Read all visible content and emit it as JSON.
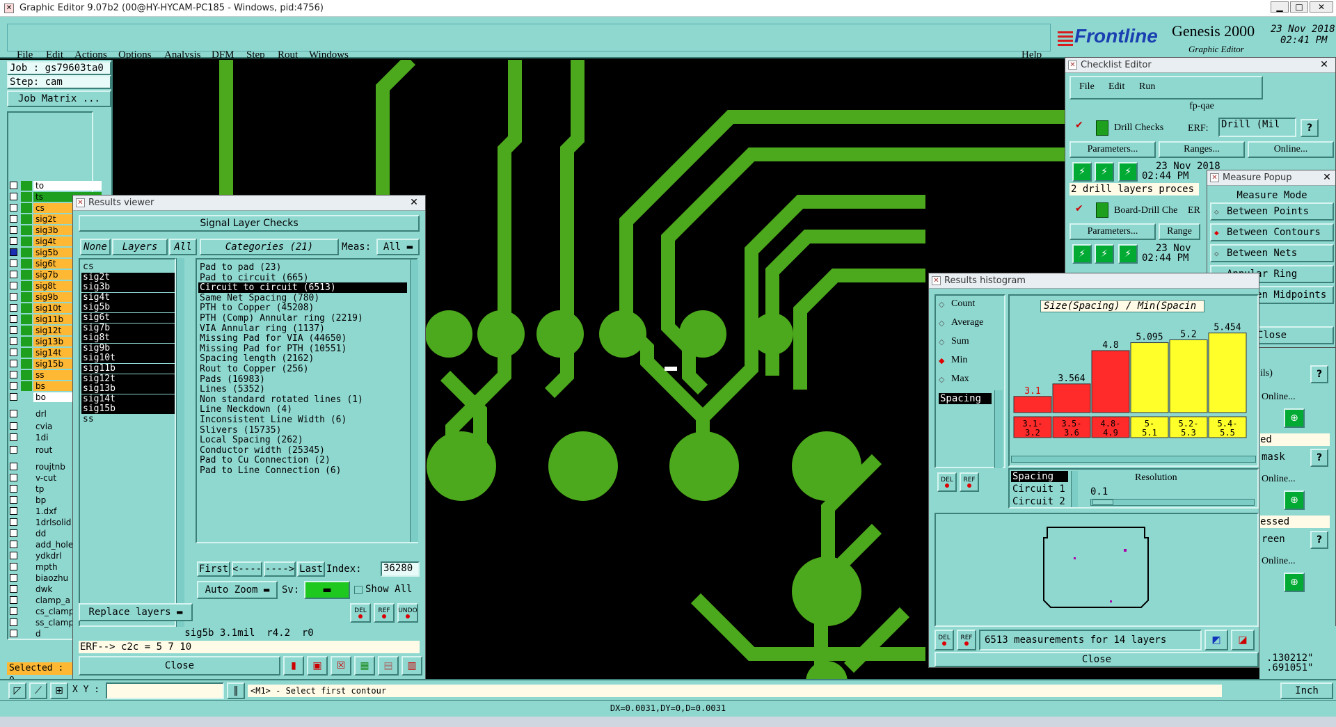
{
  "titlebar": {
    "text": "Graphic Editor 9.07b2 (00@HY-HYCAM-PC185 - Windows, pid:4756)"
  },
  "menubar": {
    "items": [
      "File",
      "Edit",
      "Actions",
      "Options",
      "Analysis",
      "DFM",
      "Step",
      "Rout",
      "Windows"
    ],
    "help": "Help"
  },
  "brand": {
    "logo": "Frontline",
    "product": "Genesis 2000",
    "subtitle": "Graphic Editor",
    "date": "23 Nov 2018",
    "time": "02:41 PM"
  },
  "left_panel": {
    "job": "Job : gs79603ta0",
    "step": "Step: cam",
    "job_matrix": "Job Matrix ...",
    "layers": [
      "to",
      "ts",
      "cs",
      "sig2t",
      "sig3b",
      "sig4t",
      "sig5b",
      "sig6t",
      "sig7b",
      "sig8t",
      "sig9b",
      "sig10t",
      "sig11b",
      "sig12t",
      "sig13b",
      "sig14t",
      "sig15b",
      "ss",
      "bs",
      "bo",
      "drl",
      "cvia",
      "1di",
      "rout",
      "roujtnb",
      "v-cut",
      "tp",
      "bp",
      "1.dxf",
      "1drlsolid",
      "dd",
      "add_hole",
      "ydkdrl",
      "mpth",
      "biaozhu",
      "dwk",
      "clamp_a",
      "cs_clamp",
      "ss_clamp",
      "d"
    ],
    "selected": "Selected : 0"
  },
  "results_viewer": {
    "title": "Results viewer",
    "header": "Signal Layer Checks",
    "none_btn": "None",
    "layers_btn": "Layers",
    "all_btn": "All",
    "categories_btn": "Categories (21)",
    "meas_label": "Meas:",
    "meas_value": "All",
    "layer_list": [
      "cs",
      "sig2t",
      "sig3b",
      "sig4t",
      "sig5b",
      "sig6t",
      "sig7b",
      "sig8t",
      "sig9b",
      "sig10t",
      "sig11b",
      "sig12t",
      "sig13b",
      "sig14t",
      "sig15b",
      "ss"
    ],
    "categories": [
      "Pad to pad (23)",
      "Pad to circuit (665)",
      "Circuit to circuit (6513)",
      "Same Net Spacing (780)",
      "PTH to Copper (45208)",
      "PTH (Comp) Annular ring (2219)",
      "VIA Annular ring (1137)",
      "Missing Pad for VIA (44650)",
      "Missing Pad for PTH (10551)",
      "Spacing length (2162)",
      "Rout to Copper (256)",
      "Pads (16983)",
      "Lines (5352)",
      "Non standard rotated lines (1)",
      "Line Neckdown (4)",
      "Inconsistent Line Width (6)",
      "Slivers (15735)",
      "Local Spacing (262)",
      "Conductor width (25345)",
      "Pad to Cu Connection (2)",
      "Pad to Line Connection (6)"
    ],
    "nav": {
      "first": "First",
      "prev": "<----",
      "next": "---->",
      "last": "Last",
      "index_label": "Index:",
      "index_value": "36280"
    },
    "auto_zoom": "Auto Zoom",
    "sv_label": "Sv:",
    "show_all": "Show All",
    "replace_layers": "Replace layers",
    "del": "DEL",
    "ref": "REF",
    "undo": "UNDO",
    "status": "sig5b 3.1mil  r4.2  r0",
    "erf": "ERF--> c2c = 5 7 10",
    "close": "Close"
  },
  "bottom": {
    "xy_label": "X Y :",
    "prompt": "<M1> - Select first contour",
    "status": "DX=0.0031,DY=0,D=0.0031",
    "inch": "Inch",
    "coords1": ".130212\"",
    "coords2": ".691051\""
  },
  "checklist_editor": {
    "title": "Checklist Editor",
    "menu": [
      "File",
      "Edit",
      "Run"
    ],
    "name": "fp-qae",
    "check1": "Drill Checks",
    "erf_label": "ERF:",
    "erf_value": "Drill (Mil",
    "params": "Parameters...",
    "ranges": "Ranges...",
    "online": "Online...",
    "date1": "23 Nov 2018",
    "time1": "02:44 PM",
    "msg1": "2 drill layers proces",
    "check2": "Board-Drill Che",
    "erf2": "ER",
    "ranges2": "Range",
    "date2": "23 Nov",
    "time2": "02:44 PM",
    "frag1": "ils)",
    "frag2": "Online...",
    "frag3": "ed",
    "frag4": "mask",
    "frag5": "Online...",
    "frag6": "essed",
    "frag7": "reen",
    "frag8": "Online..."
  },
  "measure_popup": {
    "title": "Measure Popup",
    "mode_label": "Measure Mode",
    "options": [
      "Between Points",
      "Between Contours",
      "Between Nets",
      "Annular Ring",
      "Between Midpoints"
    ],
    "selected_index": 1,
    "close": "Close"
  },
  "histogram": {
    "title": "Results histogram",
    "stats": [
      "Count",
      "Average",
      "Sum",
      "Min",
      "Max"
    ],
    "selected_stat": "Min",
    "list_item": "Spacing",
    "chart_title": "Size(Spacing) / Min(Spacin",
    "del": "DEL",
    "ref": "REF",
    "fields": [
      "Spacing",
      "Circuit 1",
      "Circuit 2"
    ],
    "resolution_label": "Resolution",
    "resolution_value": "0.1",
    "summary": "6513 measurements for 14 layers",
    "close": "Close"
  },
  "chart_data": {
    "type": "bar",
    "title": "Size(Spacing) / Min(Spacin",
    "categories": [
      "3.1-3.2",
      "3.5-3.6",
      "4.8-4.9",
      "5-5.1",
      "5.2-5.3",
      "5.4-5.5"
    ],
    "values": [
      3.1,
      3.564,
      4.8,
      5.095,
      5.2,
      5.454
    ],
    "value_labels": [
      "3.1",
      "3.564",
      "4.8",
      "5.095",
      "5.2",
      "5.454"
    ],
    "colors": [
      "#ff2a2a",
      "#ff2a2a",
      "#ff2a2a",
      "#ffff2a",
      "#ffff2a",
      "#ffff2a"
    ],
    "ylim": [
      2.5,
      5.6
    ]
  },
  "colors": {
    "panel": "#8fd8d0",
    "pcb_trace": "#4ca81c",
    "layer_orange": "#ffb833",
    "layer_green": "#1ea01e"
  }
}
